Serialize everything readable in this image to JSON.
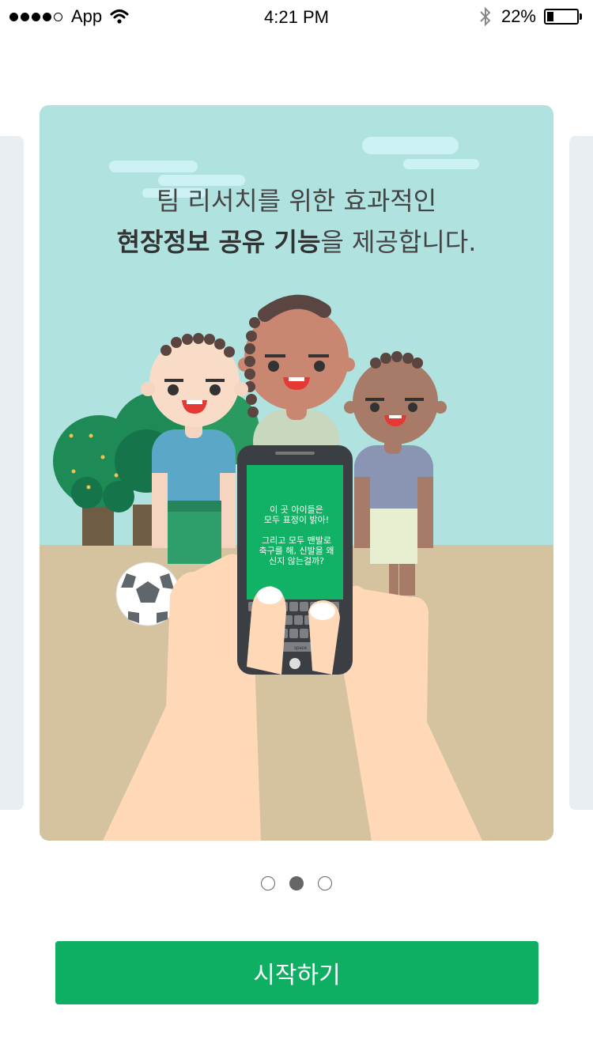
{
  "status_bar": {
    "carrier": "App",
    "time": "4:21 PM",
    "battery_percent": "22%",
    "battery_level": 0.22,
    "signal_bars": 4
  },
  "slide": {
    "headline_line1": "팀 리서치를 위한 효과적인",
    "headline_bold": "현장정보 공유 기능",
    "headline_rest": "을 제공합니다.",
    "phone_text_1a": "이 곳 아이들은",
    "phone_text_1b": "모두 표정이 밝아!",
    "phone_text_2a": "그리고 모두 맨발로",
    "phone_text_2b": "축구를 해, 신발을 왜",
    "phone_text_2c": "신지 않는걸까?",
    "keyboard_space": "space"
  },
  "pager": {
    "count": 3,
    "active_index": 1
  },
  "actions": {
    "start_label": "시작하기"
  },
  "colors": {
    "sky": "#b0e2df",
    "ground": "#d5c29e",
    "brand_green": "#0eae63",
    "side_card": "#e9eef2"
  },
  "icons": [
    "wifi-icon",
    "bluetooth-icon",
    "battery-icon"
  ]
}
